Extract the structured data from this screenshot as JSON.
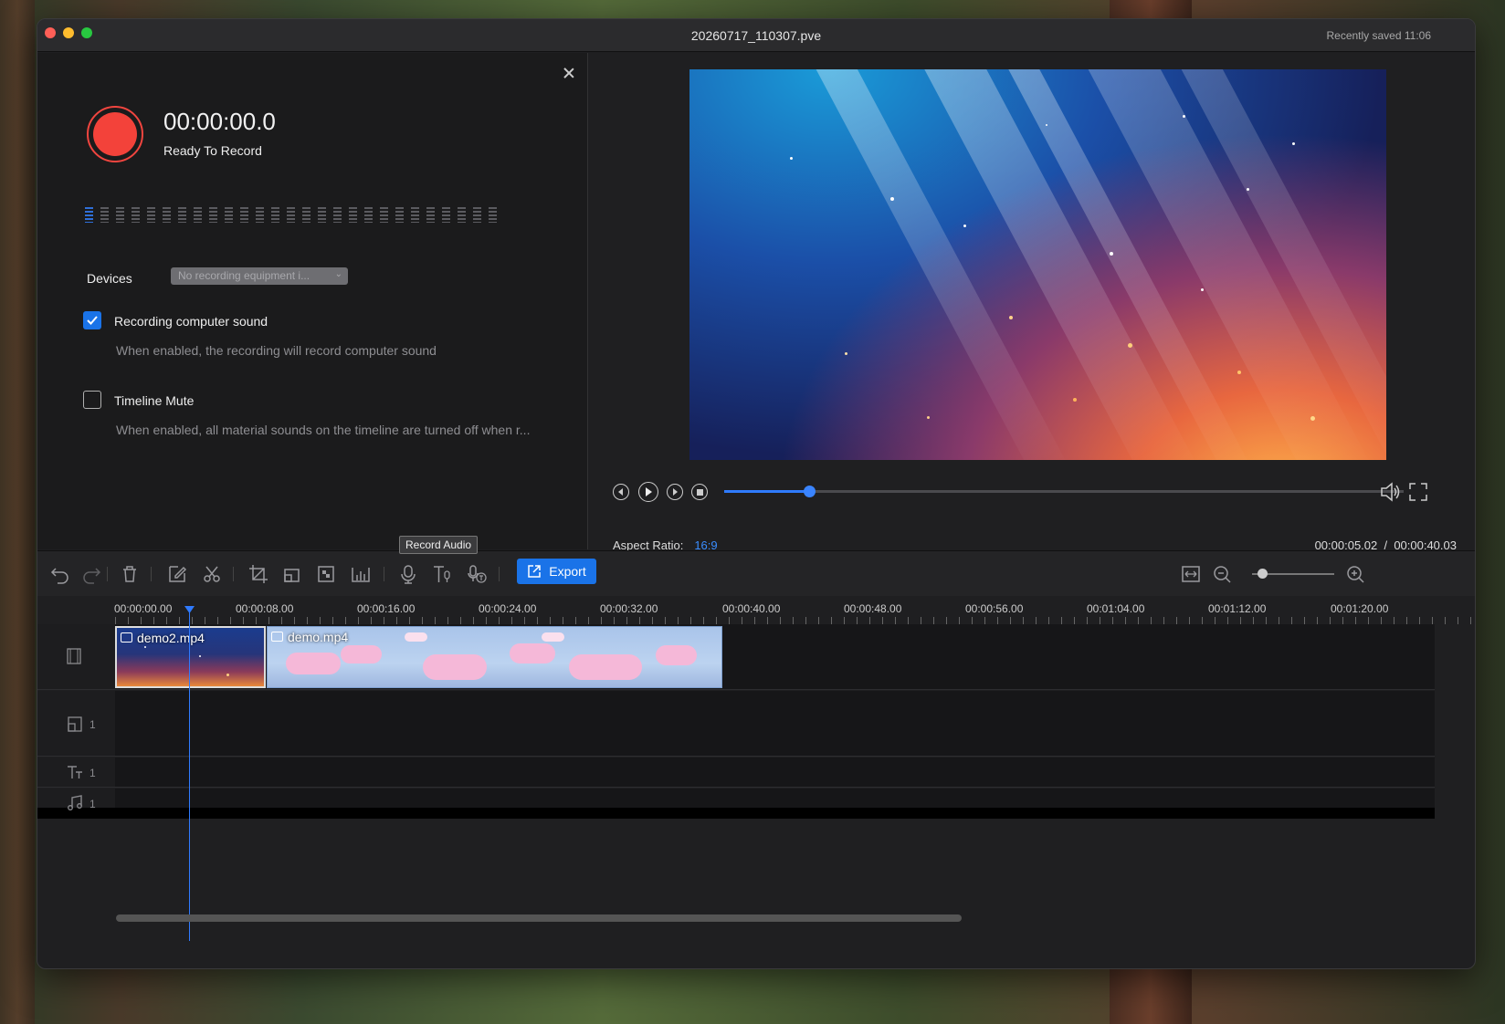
{
  "window": {
    "title": "20260717_110307.pve",
    "saved_status": "Recently saved  11:06",
    "traffic_colors": [
      "#ff5f57",
      "#febc2e",
      "#28c840"
    ]
  },
  "record_panel": {
    "timer": "00:00:00.0",
    "status": "Ready To Record",
    "devices_label": "Devices",
    "devices_value": "No recording equipment i...",
    "option1_label": "Recording computer sound",
    "option1_checked": true,
    "option1_desc": "When enabled, the recording will record computer sound",
    "option2_label": "Timeline Mute",
    "option2_checked": false,
    "option2_desc": "When enabled, all material sounds on the timeline are turned off when r..."
  },
  "preview": {
    "aspect_label": "Aspect Ratio:",
    "aspect_value": "16:9",
    "timecode": "00:00:05.02  /  00:00:40.03",
    "progress": 0.125
  },
  "toolbar": {
    "tooltip": "Record Audio",
    "export_label": "Export",
    "icons": [
      "undo-icon",
      "redo-icon",
      "delete-icon",
      "edit-icon",
      "split-icon",
      "crop-icon",
      "resize-icon",
      "mosaic-icon",
      "audio-levels-icon",
      "record-audio-icon",
      "text-to-speech-icon",
      "speech-to-text-icon"
    ]
  },
  "timeline": {
    "ruler": [
      "00:00:00.00",
      "00:00:08.00",
      "00:00:16.00",
      "00:00:24.00",
      "00:00:32.00",
      "00:00:40.00",
      "00:00:48.00",
      "00:00:56.00",
      "00:01:04.00",
      "00:01:12.00",
      "00:01:20.00"
    ],
    "clips": [
      {
        "name": "demo2.mp4"
      },
      {
        "name": "demo.mp4"
      }
    ],
    "tracks": {
      "overlay": "1",
      "text": "1",
      "audio": "1"
    }
  },
  "accent": "#1a73e8"
}
